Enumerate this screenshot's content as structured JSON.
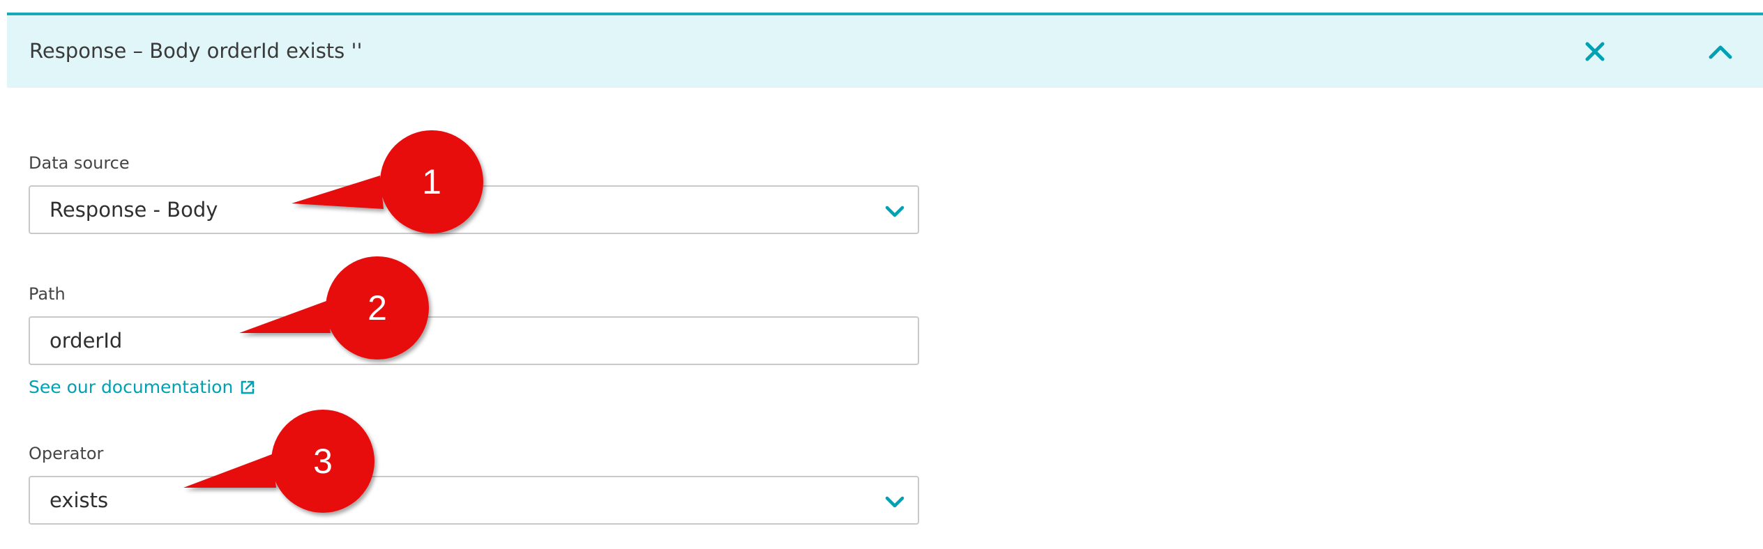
{
  "header": {
    "title": "Response – Body orderId exists ''",
    "close_icon": "close-icon",
    "collapse_icon": "chevron-up-icon"
  },
  "form": {
    "data_source": {
      "label": "Data source",
      "value": "Response - Body",
      "icon": "chevron-down-icon"
    },
    "path": {
      "label": "Path",
      "value": "orderId"
    },
    "doc_link": {
      "text": "See our documentation",
      "icon": "external-link-icon"
    },
    "operator": {
      "label": "Operator",
      "value": "exists",
      "icon": "chevron-down-icon"
    }
  },
  "callouts": [
    {
      "number": "1"
    },
    {
      "number": "2"
    },
    {
      "number": "3"
    }
  ],
  "colors": {
    "accent": "#00a1b2",
    "header_bg": "#e1f6f9",
    "header_border": "#1ba8b6",
    "callout": "#e8090d"
  }
}
